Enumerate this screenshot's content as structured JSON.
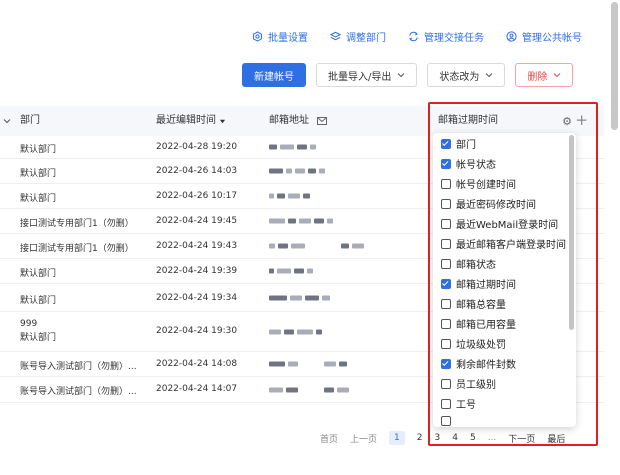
{
  "toplinks": [
    {
      "label": "批量设置",
      "icon": "settings-icon"
    },
    {
      "label": "调整部门",
      "icon": "layers-icon"
    },
    {
      "label": "管理交接任务",
      "icon": "sync-icon"
    },
    {
      "label": "管理公共帐号",
      "icon": "user-circle-icon"
    }
  ],
  "buttons": {
    "new_account": "新建帐号",
    "import_export": "批量导入/导出",
    "change_status": "状态改为",
    "delete": "删除"
  },
  "columns": {
    "department": "部门",
    "last_edit": "最近编辑时间",
    "email": "邮箱地址",
    "expire": "邮箱过期时间"
  },
  "rows": [
    {
      "dept": "默认部门",
      "time": "2022-04-28 19:20"
    },
    {
      "dept": "默认部门",
      "time": "2022-04-26 14:03"
    },
    {
      "dept": "默认部门",
      "time": "2022-04-26 10:17"
    },
    {
      "dept": "接口测试专用部门1（勿删）",
      "time": "2022-04-24 19:45"
    },
    {
      "dept": "接口测试专用部门1（勿删）",
      "time": "2022-04-24 19:43"
    },
    {
      "dept": "默认部门",
      "time": "2022-04-24 19:39"
    },
    {
      "dept": "默认部门",
      "time": "2022-04-24 19:34"
    },
    {
      "dept": "999",
      "dept_line2": "默认部门",
      "time": "2022-04-24 19:30"
    },
    {
      "dept": "账号导入测试部门（勿删）...",
      "time": "2022-04-24 14:08"
    },
    {
      "dept": "账号导入测试部门（勿删）...",
      "time": "2022-04-24 14:07"
    }
  ],
  "column_options": [
    {
      "label": "部门",
      "checked": true
    },
    {
      "label": "帐号状态",
      "checked": true
    },
    {
      "label": "帐号创建时间",
      "checked": false
    },
    {
      "label": "最近密码修改时间",
      "checked": false
    },
    {
      "label": "最近WebMail登录时间",
      "checked": false
    },
    {
      "label": "最近邮箱客户端登录时间",
      "checked": false
    },
    {
      "label": "邮箱状态",
      "checked": false
    },
    {
      "label": "邮箱过期时间",
      "checked": true
    },
    {
      "label": "邮箱总容量",
      "checked": false
    },
    {
      "label": "邮箱已用容量",
      "checked": false
    },
    {
      "label": "垃圾级处罚",
      "checked": false
    },
    {
      "label": "剩余邮件封数",
      "checked": true
    },
    {
      "label": "员工级别",
      "checked": false
    },
    {
      "label": "工号",
      "checked": false
    }
  ],
  "pagination": {
    "first": "首页",
    "prev": "上一页",
    "pages": [
      "1",
      "2",
      "3",
      "4",
      "5"
    ],
    "current": "1",
    "ellipsis": "...",
    "next": "下一页",
    "last": "最后"
  },
  "colors": {
    "accent": "#2f6fe4",
    "danger": "#e5484d",
    "highlight": "#e02020"
  }
}
